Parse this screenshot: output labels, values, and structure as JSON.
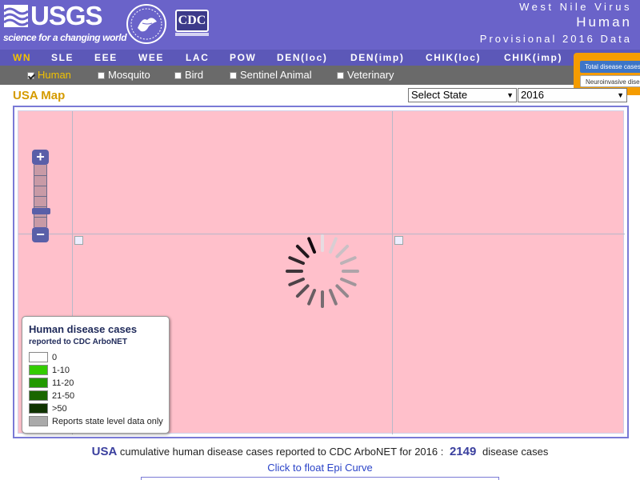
{
  "header": {
    "usgs_logo_text": "USGS",
    "usgs_tagline": "science for a changing world",
    "cdc_logo_text": "CDC",
    "title_line1": "West Nile Virus",
    "title_line2": "Human",
    "title_line3": "Provisional 2016 Data",
    "bg_color": "#6a63c9"
  },
  "nav": {
    "items": [
      {
        "label": "WN",
        "active": true
      },
      {
        "label": "SLE",
        "active": false
      },
      {
        "label": "EEE",
        "active": false
      },
      {
        "label": "WEE",
        "active": false
      },
      {
        "label": "LAC",
        "active": false
      },
      {
        "label": "POW",
        "active": false
      },
      {
        "label": "DEN(loc)",
        "active": false
      },
      {
        "label": "DEN(imp)",
        "active": false
      },
      {
        "label": "CHIK(loc)",
        "active": false
      },
      {
        "label": "CHIK(imp)",
        "active": false
      }
    ],
    "active_color": "#f2c200"
  },
  "subnav": {
    "items": [
      {
        "label": "Human",
        "checked": true
      },
      {
        "label": "Mosquito",
        "checked": false
      },
      {
        "label": "Bird",
        "checked": false
      },
      {
        "label": "Sentinel Animal",
        "checked": false
      },
      {
        "label": "Veterinary",
        "checked": false
      }
    ]
  },
  "popup": {
    "options": [
      "Total disease cases",
      "Neuroinvasive disease"
    ],
    "selected": "Total disease cases"
  },
  "map": {
    "title": "USA Map",
    "state_select": "Select State",
    "year_select": "2016",
    "bg_color": "#ffc0cb",
    "zoom_in_label": "+",
    "zoom_out_label": "−"
  },
  "legend": {
    "title": "Human disease cases",
    "subtitle": "reported to CDC ArboNET",
    "entries": [
      {
        "label": "0",
        "color": "#ffffff"
      },
      {
        "label": "1-10",
        "color": "#33cc00"
      },
      {
        "label": "11-20",
        "color": "#229900"
      },
      {
        "label": "21-50",
        "color": "#1a6600"
      },
      {
        "label": ">50",
        "color": "#0f3300"
      },
      {
        "label": "Reports state level data only",
        "color": "#aaaaaa"
      }
    ]
  },
  "summary": {
    "region": "USA",
    "text": "cumulative human disease cases reported to CDC ArboNET for 2016 :",
    "count": "2149",
    "unit": "disease cases",
    "epi_link": "Click to float Epi Curve"
  }
}
